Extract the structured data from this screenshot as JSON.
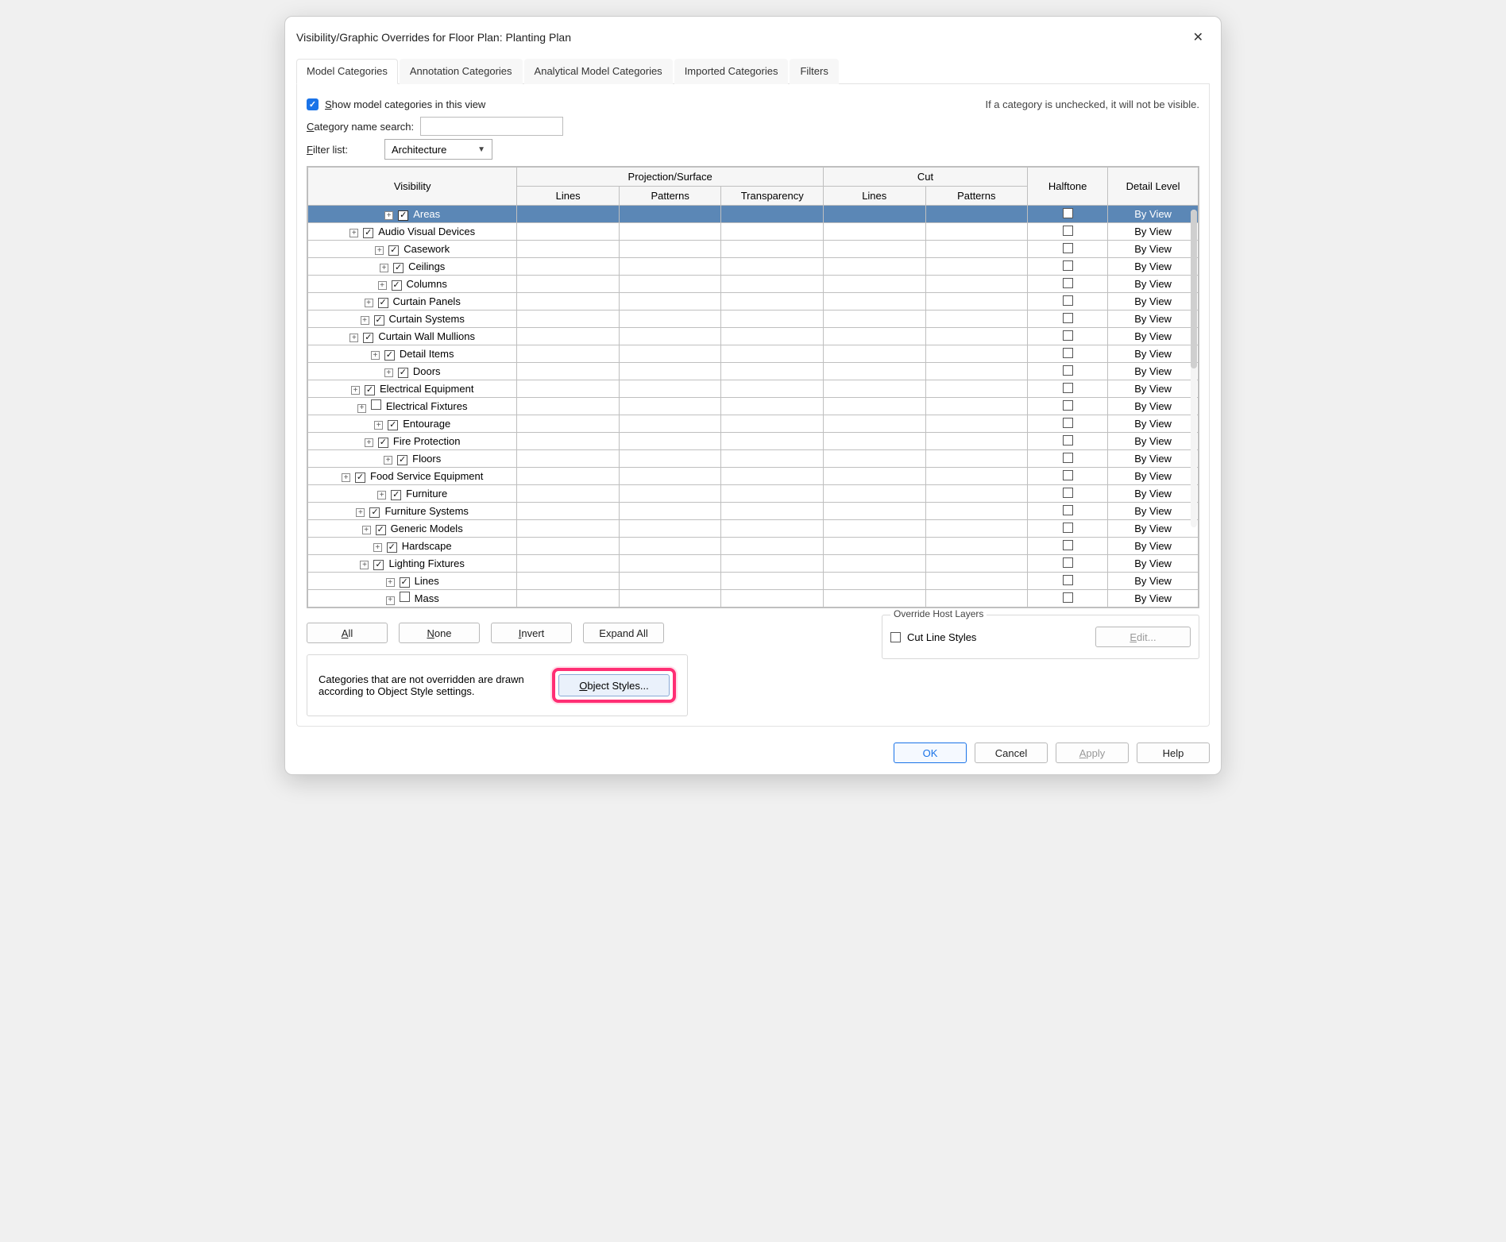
{
  "dialog": {
    "title": "Visibility/Graphic Overrides for Floor Plan: Planting Plan"
  },
  "tabs": [
    {
      "label": "Model Categories",
      "active": true
    },
    {
      "label": "Annotation Categories",
      "active": false
    },
    {
      "label": "Analytical Model Categories",
      "active": false
    },
    {
      "label": "Imported Categories",
      "active": false
    },
    {
      "label": "Filters",
      "active": false
    }
  ],
  "show_checkbox": {
    "checked": true,
    "label_pre": "S",
    "label_rest": "how model categories in this view"
  },
  "hint_right": "If a category is unchecked, it will not be visible.",
  "searchrow": {
    "label_pre": "C",
    "label_rest": "ategory name search:"
  },
  "filterrow": {
    "label_pre": "F",
    "label_rest": "ilter list:",
    "value": "Architecture"
  },
  "headers": {
    "visibility": "Visibility",
    "proj": "Projection/Surface",
    "cut": "Cut",
    "halftone": "Halftone",
    "detail": "Detail Level",
    "lines": "Lines",
    "patterns": "Patterns",
    "transparency": "Transparency"
  },
  "rows": [
    {
      "name": "Areas",
      "checked": true,
      "selected": true,
      "cut_na": false
    },
    {
      "name": "Audio Visual Devices",
      "checked": true,
      "cut_na": false
    },
    {
      "name": "Casework",
      "checked": true,
      "cut_na": false
    },
    {
      "name": "Ceilings",
      "checked": true,
      "cut_na": false
    },
    {
      "name": "Columns",
      "checked": true,
      "cut_na": false
    },
    {
      "name": "Curtain Panels",
      "checked": true,
      "cut_na": false
    },
    {
      "name": "Curtain Systems",
      "checked": true,
      "cut_na": false
    },
    {
      "name": "Curtain Wall Mullions",
      "checked": true,
      "cut_na": false
    },
    {
      "name": "Detail Items",
      "checked": true,
      "cut_na": true
    },
    {
      "name": "Doors",
      "checked": true,
      "cut_na": false
    },
    {
      "name": "Electrical Equipment",
      "checked": true,
      "cut_na": true
    },
    {
      "name": "Electrical Fixtures",
      "checked": false,
      "cut_na": true
    },
    {
      "name": "Entourage",
      "checked": true,
      "cut_na": true
    },
    {
      "name": "Fire Protection",
      "checked": true,
      "cut_na": true
    },
    {
      "name": "Floors",
      "checked": true,
      "cut_na": false
    },
    {
      "name": "Food Service Equipment",
      "checked": true,
      "cut_na": false
    },
    {
      "name": "Furniture",
      "checked": true,
      "cut_na": false
    },
    {
      "name": "Furniture Systems",
      "checked": true,
      "cut_na": false
    },
    {
      "name": "Generic Models",
      "checked": true,
      "cut_na": false
    },
    {
      "name": "Hardscape",
      "checked": true,
      "cut_na": false
    },
    {
      "name": "Lighting Fixtures",
      "checked": true,
      "cut_na": true
    },
    {
      "name": "Lines",
      "checked": true,
      "cut_na": true,
      "proj_patterns_na": true,
      "proj_transparency_na": true
    },
    {
      "name": "Mass",
      "checked": false,
      "cut_na": false
    }
  ],
  "detail_default": "By View",
  "bottom_buttons": {
    "all": {
      "pre": "A",
      "rest": "ll"
    },
    "none": {
      "pre": "N",
      "rest": "one"
    },
    "invert": {
      "pre": "I",
      "rest": "nvert"
    },
    "expand": {
      "label": "Expand All"
    }
  },
  "override_group": {
    "legend": "Override Host Layers",
    "cut_label": "Cut Line Styles",
    "edit_pre": "E",
    "edit_rest": "dit..."
  },
  "help_text": "Categories that are not overridden are drawn according to Object Style settings.",
  "object_styles": {
    "pre": "O",
    "rest": "bject Styles..."
  },
  "footer": {
    "ok": "OK",
    "cancel": "Cancel",
    "apply_pre": "A",
    "apply_rest": "pply",
    "help": "Help"
  }
}
